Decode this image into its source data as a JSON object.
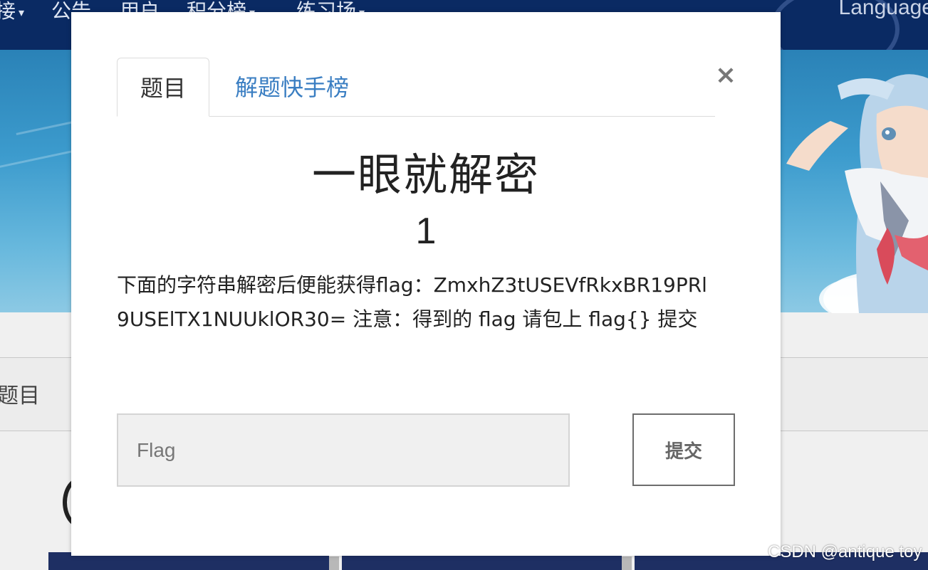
{
  "navbar": {
    "items": [
      {
        "label": "接",
        "has_caret": true
      },
      {
        "label": "公告",
        "has_caret": false
      },
      {
        "label": "用户",
        "has_caret": false
      },
      {
        "label": "积分榜",
        "has_caret": true
      },
      {
        "label": "练习场",
        "has_caret": true
      }
    ],
    "language_label": "Language",
    "caret_glyph": "▾"
  },
  "background": {
    "tab_label": "题目"
  },
  "modal": {
    "close_glyph": "×",
    "tabs": [
      {
        "label": "题目",
        "active": true
      },
      {
        "label": "解题快手榜",
        "active": false
      }
    ],
    "challenge": {
      "title": "一眼就解密",
      "points": "1",
      "description": "下面的字符串解密后便能获得flag：ZmxhZ3tUSEVfRkxBR19PRl9USElTX1NUUklOR30= 注意：得到的 flag 请包上 flag{} 提交"
    },
    "flag_input": {
      "placeholder": "Flag",
      "value": ""
    },
    "submit_label": "提交"
  },
  "watermark": "CSDN @antique toy",
  "colors": {
    "navbar": "#0a2a63",
    "tab_link": "#3a7ec2",
    "banner": "#3c9bcd"
  }
}
